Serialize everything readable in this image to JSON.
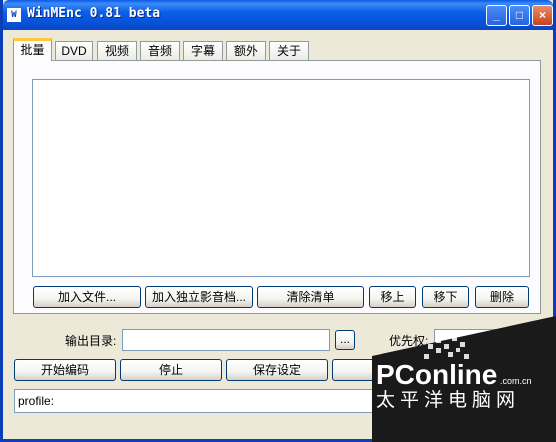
{
  "window": {
    "title": "WinMEnc 0.81 beta"
  },
  "titlebar": {
    "minimize": "_",
    "maximize": "□",
    "close": "×"
  },
  "tabs": [
    {
      "label": "批量",
      "active": true
    },
    {
      "label": "DVD"
    },
    {
      "label": "视频"
    },
    {
      "label": "音频"
    },
    {
      "label": "字幕"
    },
    {
      "label": "额外"
    },
    {
      "label": "关于"
    }
  ],
  "batch": {
    "buttons": {
      "add_file": "加入文件...",
      "add_separate": "加入独立影音档...",
      "clear_list": "清除清单",
      "move_up": "移上",
      "move_down": "移下",
      "delete": "删除"
    }
  },
  "output": {
    "label": "输出目录:",
    "value": "",
    "browse": "...",
    "priority_label": "优先权:",
    "priority_value": ""
  },
  "actions": {
    "start": "开始编码",
    "stop": "停止",
    "save": "保存设定",
    "partial": "清"
  },
  "status": {
    "text": "profile:"
  },
  "watermark": {
    "brand": "PConline",
    "domain": ".com.cn",
    "slogan": "太平洋电脑网"
  }
}
